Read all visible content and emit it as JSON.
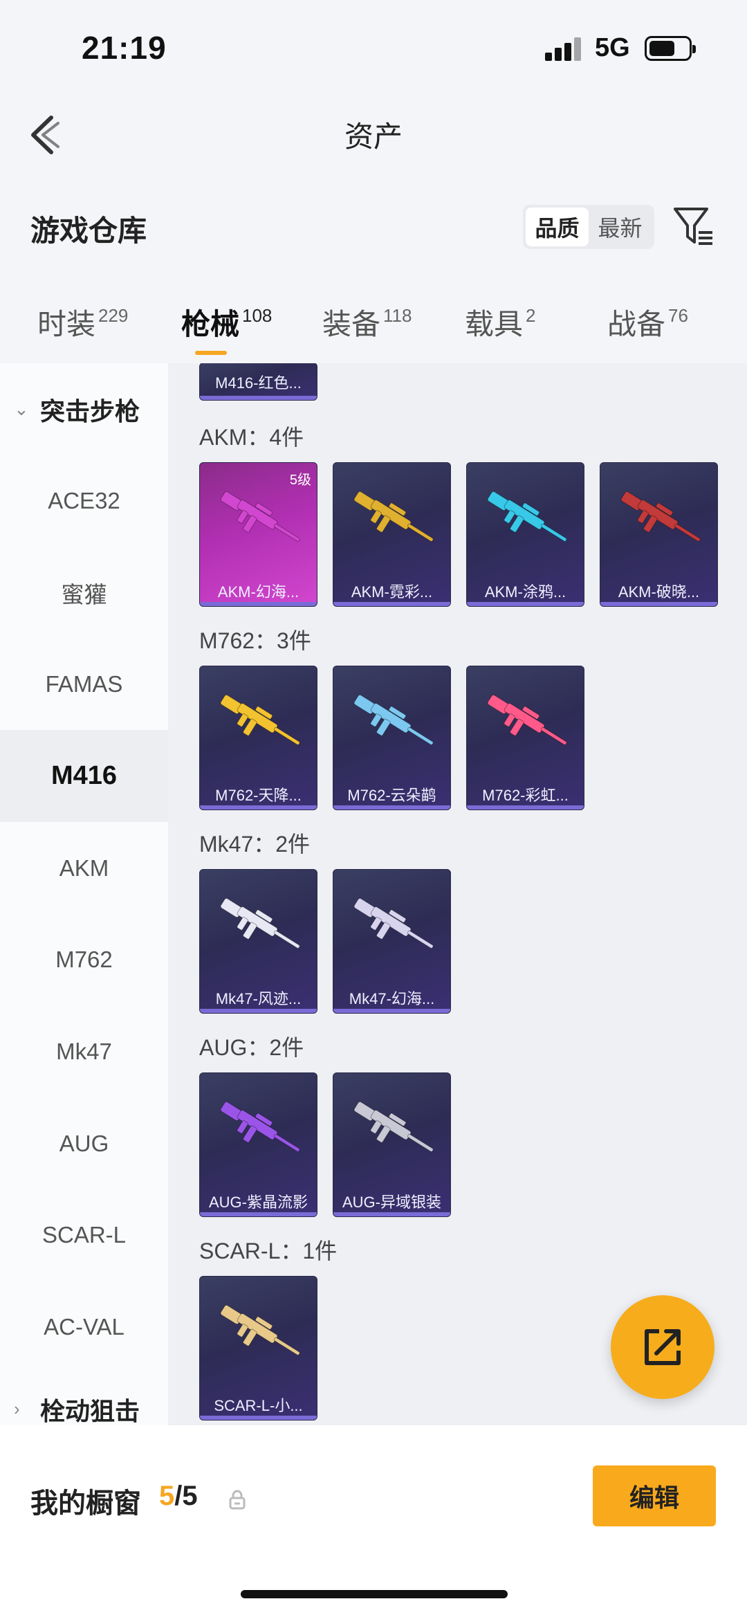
{
  "status_bar": {
    "time": "21:19",
    "network": "5G"
  },
  "nav": {
    "title": "资产"
  },
  "warehouse": {
    "title": "游戏仓库",
    "sort_options": [
      "品质",
      "最新"
    ],
    "active_sort": "品质"
  },
  "tabs": [
    {
      "label": "时装",
      "count": "229"
    },
    {
      "label": "枪械",
      "count": "108",
      "active": true
    },
    {
      "label": "装备",
      "count": "118"
    },
    {
      "label": "载具",
      "count": "2"
    },
    {
      "label": "战备",
      "count": "76"
    }
  ],
  "sidebar": {
    "group_top": "突击步枪",
    "items": [
      "ACE32",
      "蜜獾",
      "FAMAS",
      "M416",
      "AKM",
      "M762",
      "Mk47",
      "AUG",
      "SCAR-L",
      "AC-VAL"
    ],
    "selected": "M416",
    "group_bottom": "栓动狙击"
  },
  "content": {
    "partial_card": {
      "name": "M416-红色..."
    },
    "sections": [
      {
        "label": "AKM：4件",
        "items": [
          {
            "name": "AKM-幻海...",
            "tier": "5级",
            "color": "#d247cf"
          },
          {
            "name": "AKM-霓彩...",
            "color": "#e0b030"
          },
          {
            "name": "AKM-涂鸦...",
            "color": "#38c8e8"
          },
          {
            "name": "AKM-破晓...",
            "color": "#c23a3a"
          }
        ]
      },
      {
        "label": "M762：3件",
        "items": [
          {
            "name": "M762-天降...",
            "color": "#f2c230"
          },
          {
            "name": "M762-云朵鹋",
            "color": "#7cc8f0"
          },
          {
            "name": "M762-彩虹...",
            "color": "#ff5a8a"
          }
        ]
      },
      {
        "label": "Mk47：2件",
        "items": [
          {
            "name": "Mk47-风迹...",
            "color": "#e8e8f4"
          },
          {
            "name": "Mk47-幻海...",
            "color": "#d8d4ee"
          }
        ]
      },
      {
        "label": "AUG：2件",
        "items": [
          {
            "name": "AUG-紫晶流影",
            "color": "#9a55e8"
          },
          {
            "name": "AUG-异域银装",
            "color": "#c9c9d6"
          }
        ]
      },
      {
        "label": "SCAR-L：1件",
        "items": [
          {
            "name": "SCAR-L-小...",
            "color": "#e8c98a"
          }
        ]
      }
    ]
  },
  "bottom": {
    "showcase_title": "我的橱窗",
    "showcase_current": "5",
    "showcase_total": "/5",
    "edit_label": "编辑"
  },
  "colors": {
    "accent": "#f6a623",
    "card_bg": "#2e2c55",
    "legend_card": "#b12fb2"
  }
}
